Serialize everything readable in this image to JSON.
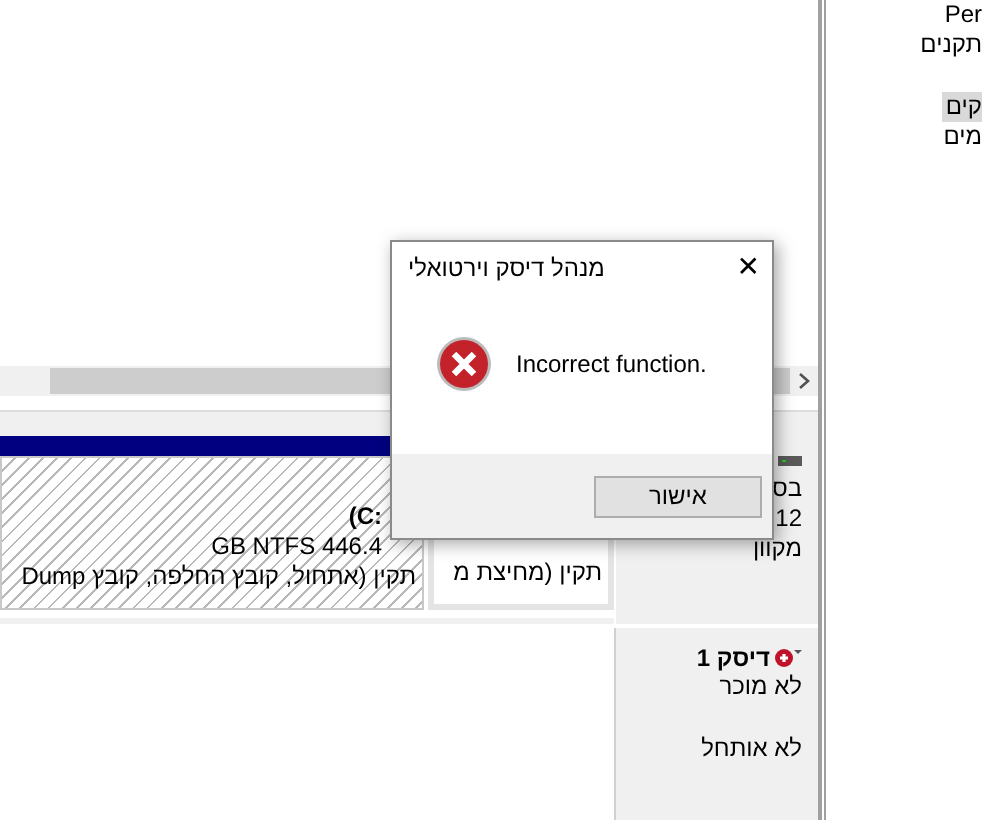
{
  "right_pane": {
    "groups": [
      [
        {
          "label": "Per",
          "selected": false
        },
        {
          "label": "תקנים",
          "selected": false
        }
      ],
      [
        {
          "label": "קים",
          "selected": true
        },
        {
          "label": "מים",
          "selected": false
        }
      ]
    ]
  },
  "disk_0": {
    "lines": [
      "בס",
      "12",
      "מקוון"
    ],
    "partitions": [
      {
        "lines": [
          "תקין (מחיצת מ"
        ],
        "selected": false
      },
      {
        "lines": [
          "(C:",
          "GB NTFS 446.4",
          "תקין (אתחול, קובץ החלפה, קובץ Dump"
        ],
        "selected": true
      }
    ]
  },
  "disk_1": {
    "name": "דיסק 1",
    "error": true,
    "status": "לא מוכר",
    "state": "לא אותחל"
  },
  "dialog": {
    "title": "מנהל דיסק וירטואלי",
    "close": "✕",
    "message": "Incorrect function.",
    "button": "אישור"
  }
}
